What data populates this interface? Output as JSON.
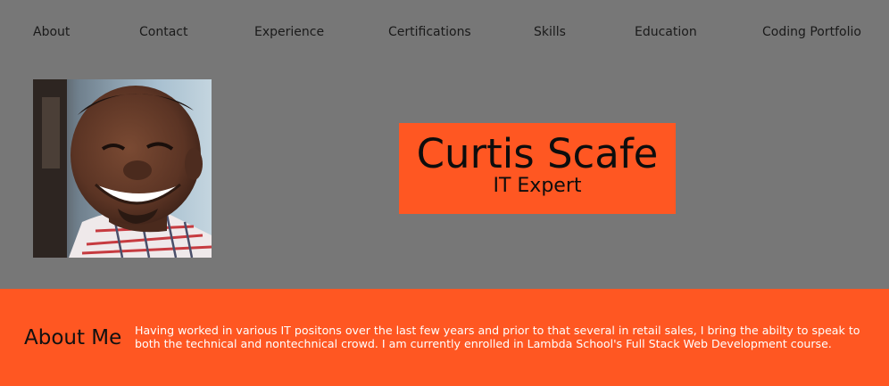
{
  "nav": {
    "items": [
      {
        "label": "About"
      },
      {
        "label": "Contact"
      },
      {
        "label": "Experience"
      },
      {
        "label": "Certifications"
      },
      {
        "label": "Skills"
      },
      {
        "label": "Education"
      },
      {
        "label": "Coding Portfolio"
      }
    ]
  },
  "profile": {
    "photo_icon": "profile-photo",
    "name": "Curtis Scafe",
    "role": "IT Expert"
  },
  "about": {
    "title": "About Me",
    "text": "Having worked in various IT positons over the last few years and prior to that several in retail sales, I bring the abilty to speak to both the technical and nontechnical crowd. I am currently enrolled in Lambda School's Full Stack Web Development course."
  },
  "colors": {
    "background": "#777777",
    "accent": "#ff5722",
    "about_text": "#ffffff"
  }
}
